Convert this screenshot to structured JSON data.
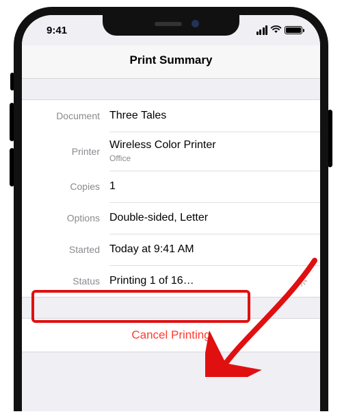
{
  "status": {
    "time": "9:41"
  },
  "header": {
    "title": "Print Summary"
  },
  "rows": {
    "document": {
      "label": "Document",
      "value": "Three Tales"
    },
    "printer": {
      "label": "Printer",
      "value": "Wireless Color Printer",
      "sub": "Office"
    },
    "copies": {
      "label": "Copies",
      "value": "1"
    },
    "options": {
      "label": "Options",
      "value": "Double-sided, Letter"
    },
    "started": {
      "label": "Started",
      "value": "Today at 9:41 AM"
    },
    "status": {
      "label": "Status",
      "value": "Printing 1 of 16…"
    }
  },
  "cancel": {
    "label": "Cancel Printing"
  }
}
